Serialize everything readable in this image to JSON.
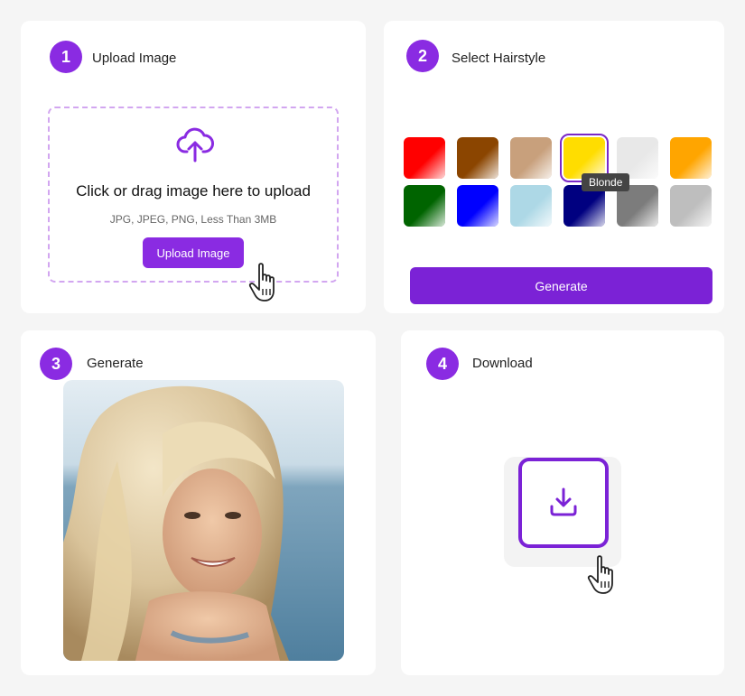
{
  "steps": {
    "upload": {
      "number": "1",
      "title": "Upload Image",
      "dropzone_title": "Click or drag image here to upload",
      "dropzone_sub": "JPG, JPEG, PNG, Less Than 3MB",
      "button_label": "Upload Image"
    },
    "hairstyle": {
      "number": "2",
      "title": "Select Hairstyle",
      "tooltip": "Blonde",
      "button_label": "Generate",
      "colors": [
        {
          "name": "red",
          "hex": "#ff0000"
        },
        {
          "name": "brown",
          "hex": "#8b4500"
        },
        {
          "name": "tan",
          "hex": "#c8a07c"
        },
        {
          "name": "blonde",
          "hex": "#ffdd00",
          "selected": true
        },
        {
          "name": "white",
          "hex": "#e8e8e8"
        },
        {
          "name": "orange",
          "hex": "#ffa500"
        },
        {
          "name": "green",
          "hex": "#006400"
        },
        {
          "name": "blue",
          "hex": "#0000ff"
        },
        {
          "name": "light-blue",
          "hex": "#add8e6"
        },
        {
          "name": "navy",
          "hex": "#000080"
        },
        {
          "name": "gray",
          "hex": "#7c7c7c"
        },
        {
          "name": "silver",
          "hex": "#bebebe"
        }
      ]
    },
    "generate": {
      "number": "3",
      "title": "Generate"
    },
    "download": {
      "number": "4",
      "title": "Download"
    }
  },
  "colors": {
    "accent": "#8a2be2",
    "button": "#7b22d6",
    "background": "#f5f5f5"
  }
}
